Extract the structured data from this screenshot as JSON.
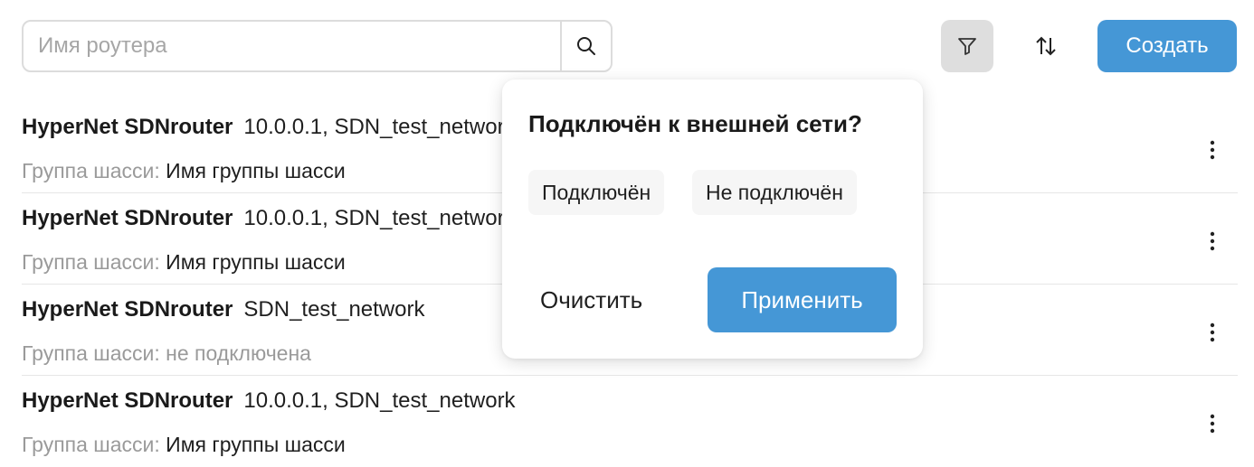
{
  "toolbar": {
    "search": {
      "placeholder": "Имя роутера",
      "value": ""
    },
    "create_label": "Создать"
  },
  "routers": [
    {
      "name": "HyperNet SDNrouter",
      "networks": "10.0.0.1, SDN_test_network",
      "group_label": "Группа шасси:",
      "group_value": "Имя группы шасси"
    },
    {
      "name": "HyperNet SDNrouter",
      "networks": "10.0.0.1, SDN_test_network",
      "group_label": "Группа шасси:",
      "group_value": "Имя группы шасси"
    },
    {
      "name": "HyperNet SDNrouter",
      "networks": "SDN_test_network",
      "group_label": "Группа шасси:",
      "group_value": "не подключена"
    },
    {
      "name": "HyperNet SDNrouter",
      "networks": "10.0.0.1, SDN_test_network",
      "group_label": "Группа шасси:",
      "group_value": "Имя группы шасси"
    }
  ],
  "filter_popover": {
    "title": "Подключён к внешней сети?",
    "options": [
      "Подключён",
      "Не подключён"
    ],
    "clear_label": "Очистить",
    "apply_label": "Применить"
  },
  "colors": {
    "accent": "#4597d6",
    "muted_text": "#9a9a9a",
    "active_filter_bg": "#dedede"
  },
  "icons": {
    "search": "search-icon",
    "filter": "filter-icon",
    "sort": "sort-icon",
    "row_menu": "kebab-menu-icon"
  }
}
